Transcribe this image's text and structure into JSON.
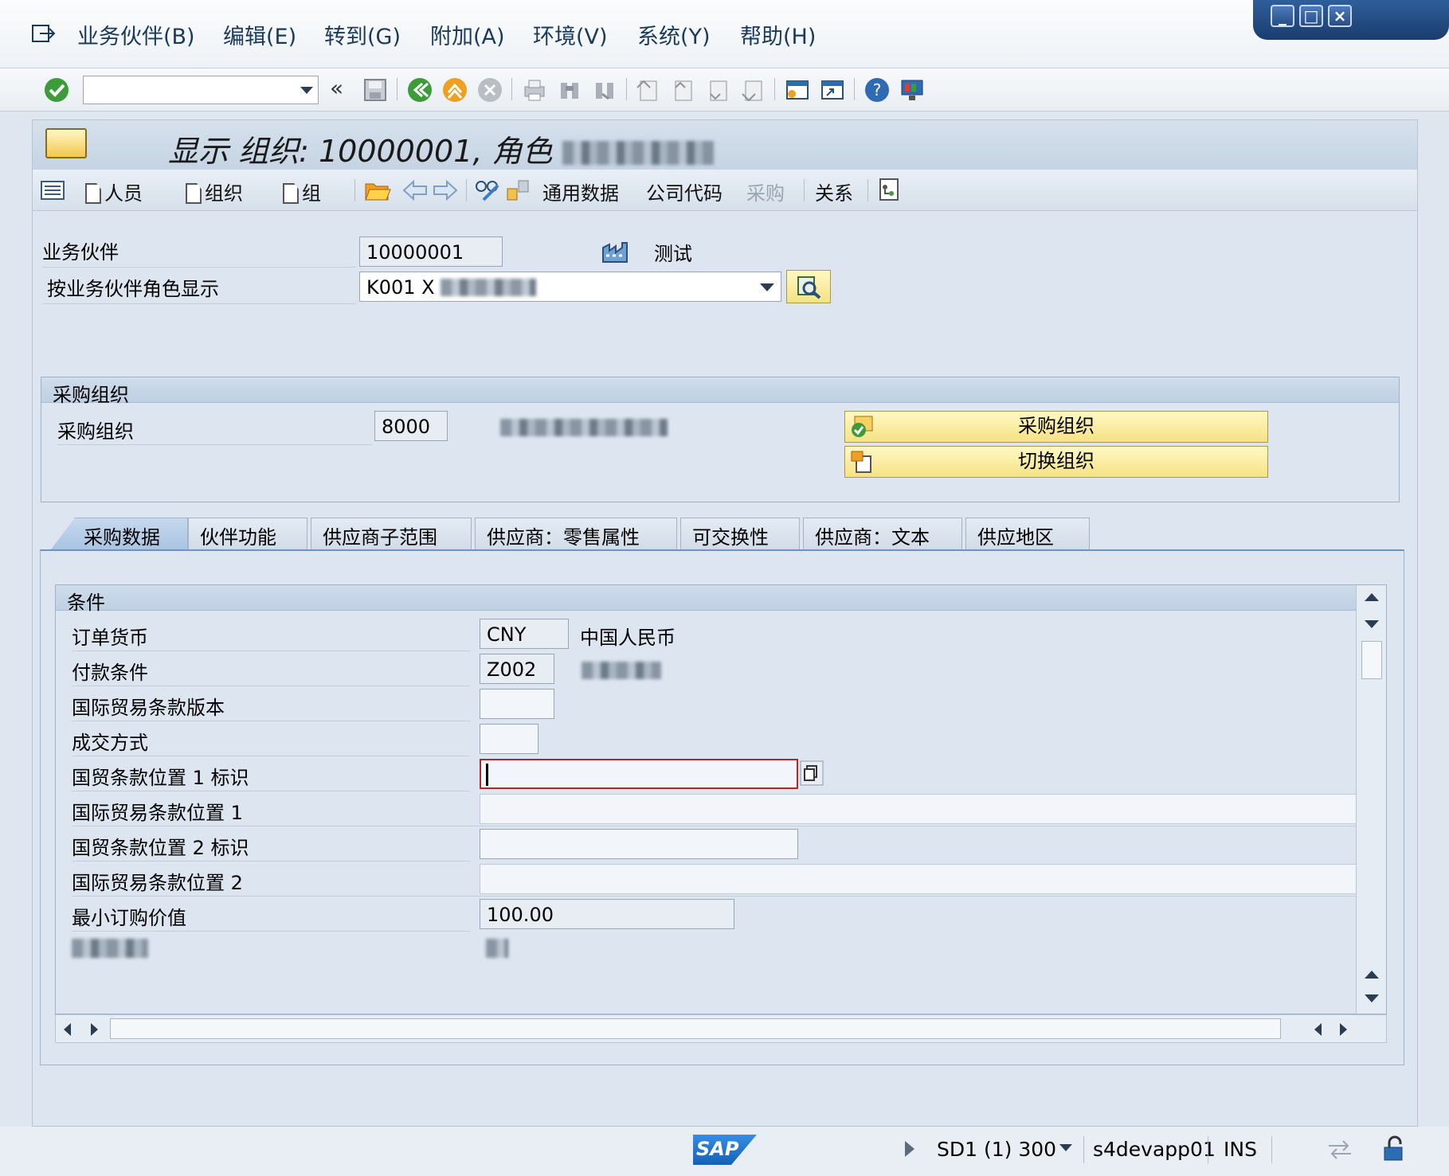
{
  "menubar": {
    "items": [
      "业务伙伴(B)",
      "编辑(E)",
      "转到(G)",
      "附加(A)",
      "环境(V)",
      "系统(Y)",
      "帮助(H)"
    ]
  },
  "toolbar": {
    "command_value": "",
    "icons": [
      "enter-icon",
      "back-icon",
      "save-icon",
      "back-green-icon",
      "exit-icon",
      "cancel-icon",
      "print-icon",
      "find-icon",
      "find-next-icon",
      "first-page-icon",
      "prev-page-icon",
      "next-page-icon",
      "last-page-icon",
      "new-session-icon",
      "shortcut-icon",
      "help-icon",
      "customize-layout-icon"
    ]
  },
  "window": {
    "title_prefix": "显示 组织: 10000001, 角色"
  },
  "app_toolbar": {
    "person": "人员",
    "organization": "组织",
    "group": "组",
    "general_data": "通用数据",
    "company_code": "公司代码",
    "purchasing": "采购",
    "relationships": "关系"
  },
  "header": {
    "bp_label": "业务伙伴",
    "bp_value": "10000001",
    "bp_desc": "测试",
    "role_label": "按业务伙伴角色显示",
    "role_value": "K001  X"
  },
  "purch_org_group": {
    "title": "采购组织",
    "label": "采购组织",
    "value": "8000",
    "btn_purch_org": "采购组织",
    "btn_switch_org": "切换组织"
  },
  "tabs": [
    "采购数据",
    "伙伴功能",
    "供应商子范围",
    "供应商：零售属性",
    "可交换性",
    "供应商：文本",
    "供应地区"
  ],
  "conditions": {
    "title": "条件",
    "rows": [
      {
        "label": "订单货币",
        "value": "CNY",
        "desc": "中国人民币"
      },
      {
        "label": "付款条件",
        "value": "Z002",
        "desc": ""
      },
      {
        "label": "国际贸易条款版本",
        "value": ""
      },
      {
        "label": "成交方式",
        "value": ""
      },
      {
        "label": "国贸条款位置 1 标识",
        "value": ""
      },
      {
        "label": "国际贸易条款位置 1",
        "value": ""
      },
      {
        "label": "国贸条款位置 2 标识",
        "value": ""
      },
      {
        "label": "国际贸易条款位置 2",
        "value": ""
      },
      {
        "label": "最小订购价值",
        "value": "100.00"
      }
    ]
  },
  "statusbar": {
    "logo": "SAP",
    "system": "SD1 (1) 300",
    "server": "s4devapp01",
    "mode": "INS"
  }
}
